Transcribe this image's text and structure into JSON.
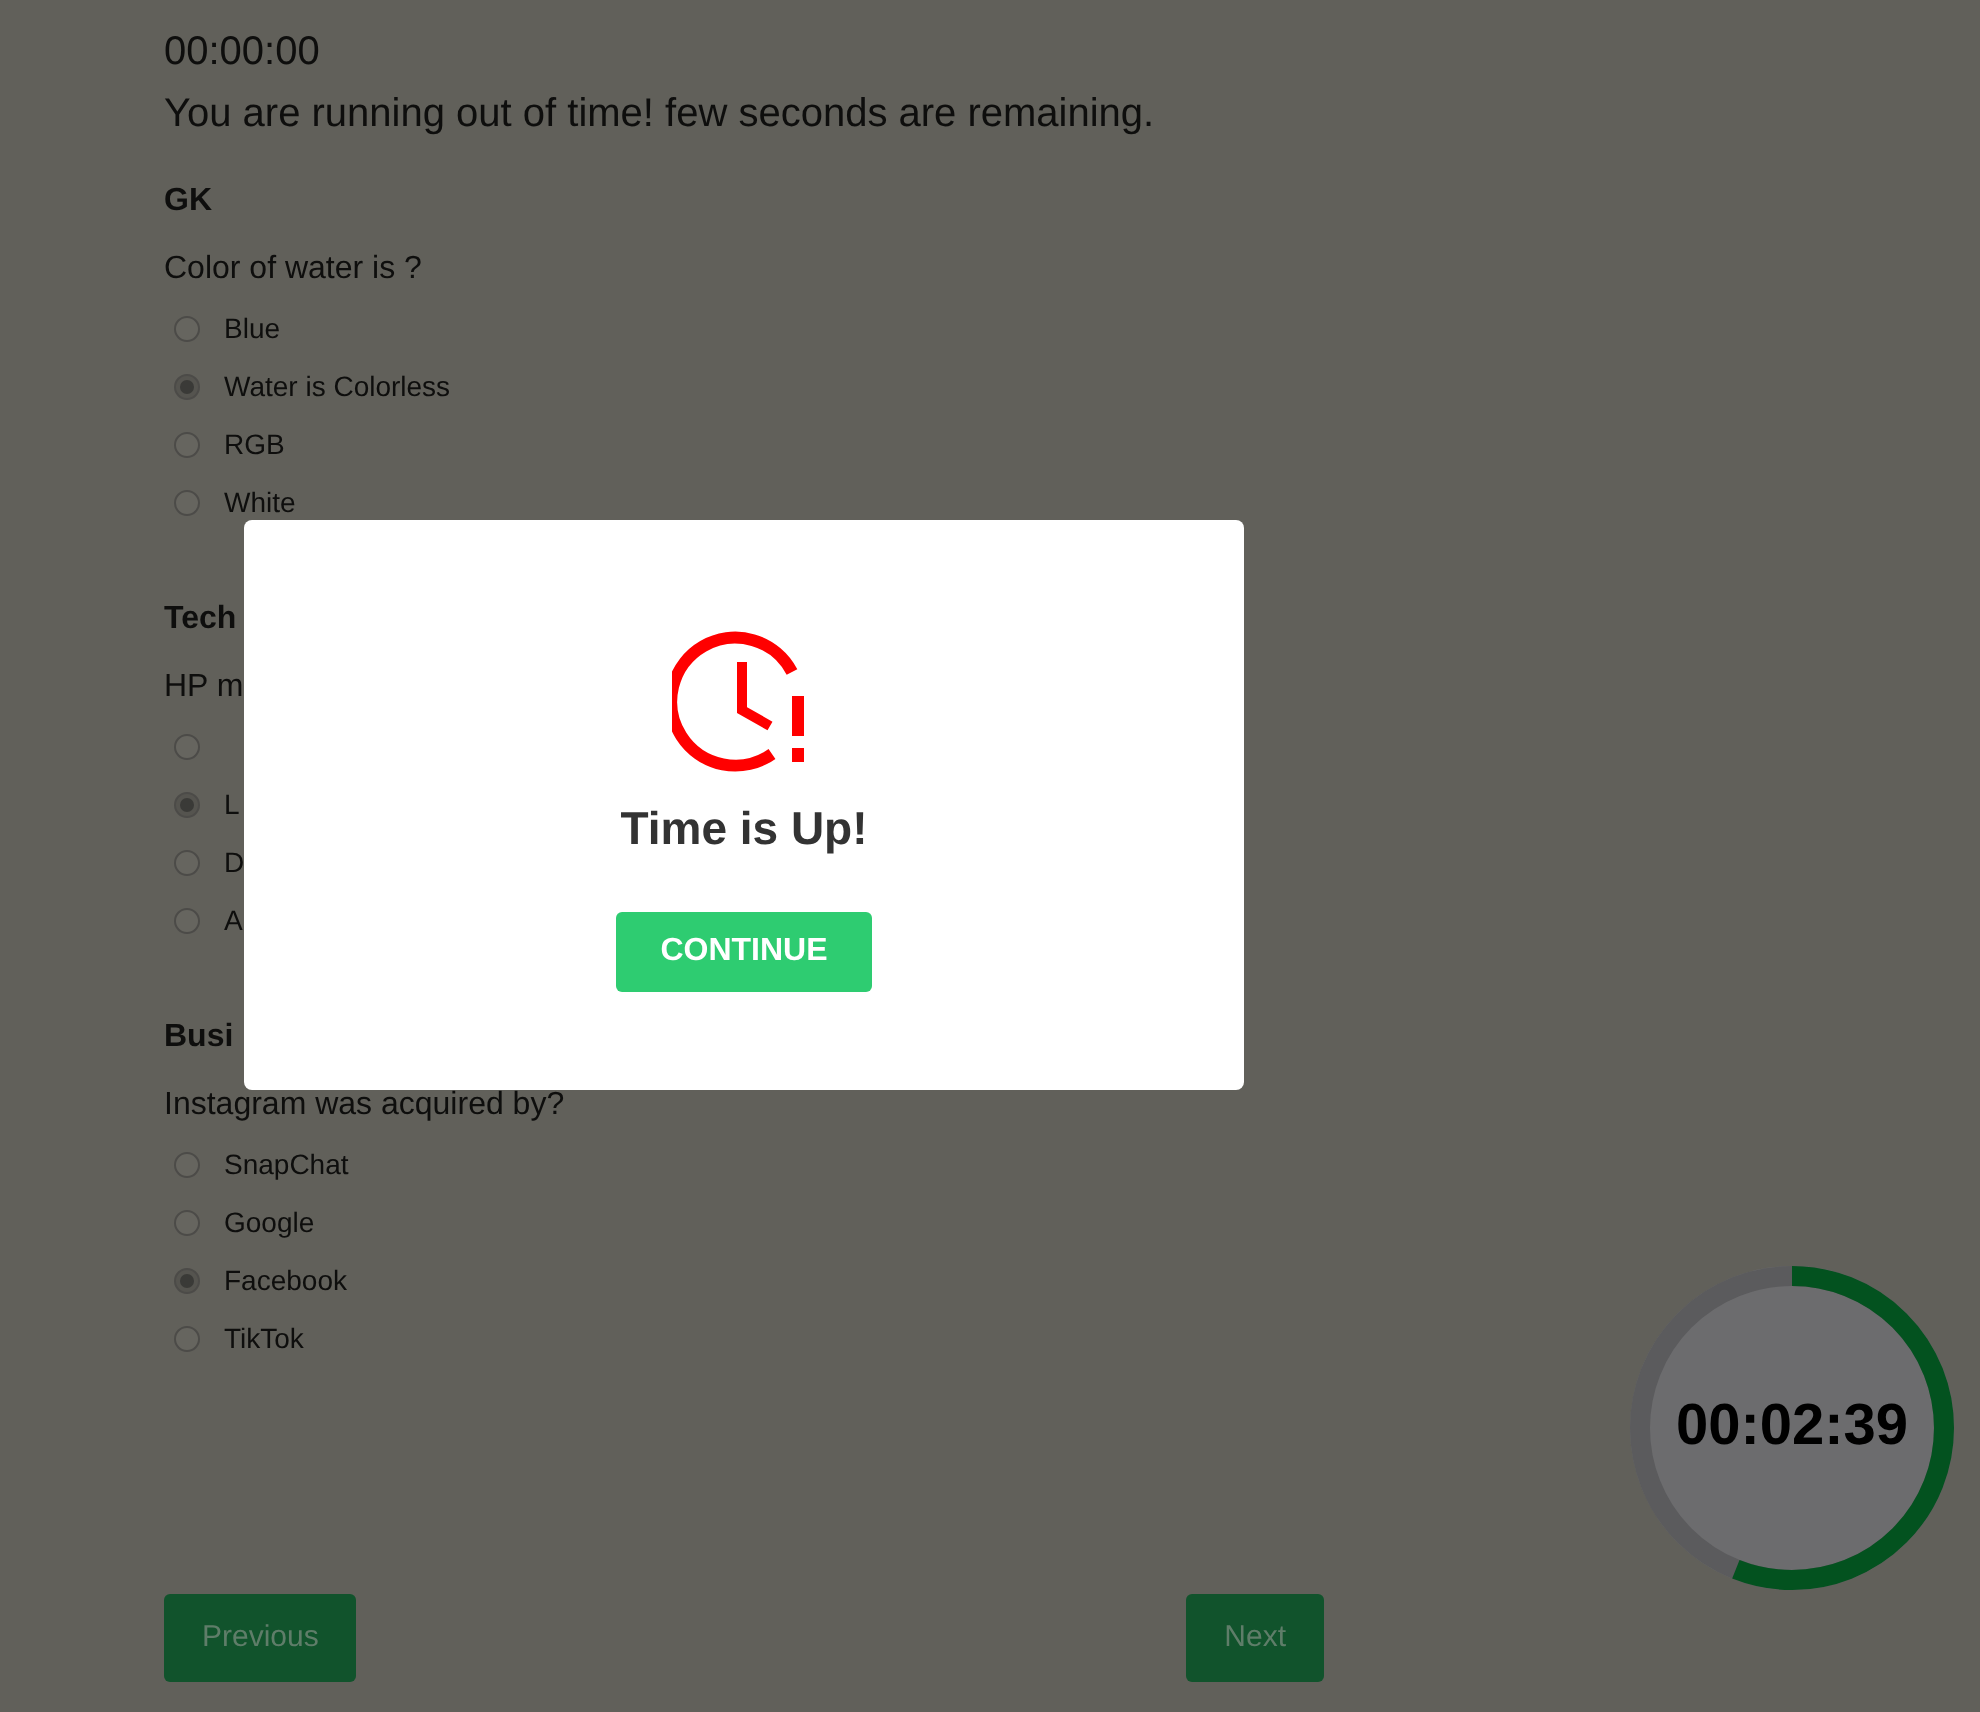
{
  "countdown": "00:00:00",
  "warning": "You are running out of time! few seconds are remaining.",
  "sections": [
    {
      "title": "GK",
      "question": "Color of water is ?",
      "options": [
        {
          "label": "Blue",
          "selected": false
        },
        {
          "label": "Water is Colorless",
          "selected": true
        },
        {
          "label": "RGB",
          "selected": false
        },
        {
          "label": "White",
          "selected": false
        }
      ]
    },
    {
      "title": "Tech",
      "question": "HP m",
      "options": [
        {
          "selected": false
        },
        {
          "label": "L",
          "selected": true
        },
        {
          "label": "D",
          "selected": false
        },
        {
          "label": "A",
          "selected": false
        }
      ]
    },
    {
      "title": "Busi",
      "question": "Instagram was acquired by?",
      "options": [
        {
          "label": "SnapChat",
          "selected": false
        },
        {
          "label": "Google",
          "selected": false
        },
        {
          "label": "Facebook",
          "selected": true
        },
        {
          "label": "TikTok",
          "selected": false
        }
      ]
    }
  ],
  "nav": {
    "previous": "Previous",
    "next": "Next"
  },
  "timer": {
    "time": "00:02:39",
    "level": 0.56
  },
  "modal": {
    "title": "Time is Up!",
    "button": "CONTINUE"
  }
}
